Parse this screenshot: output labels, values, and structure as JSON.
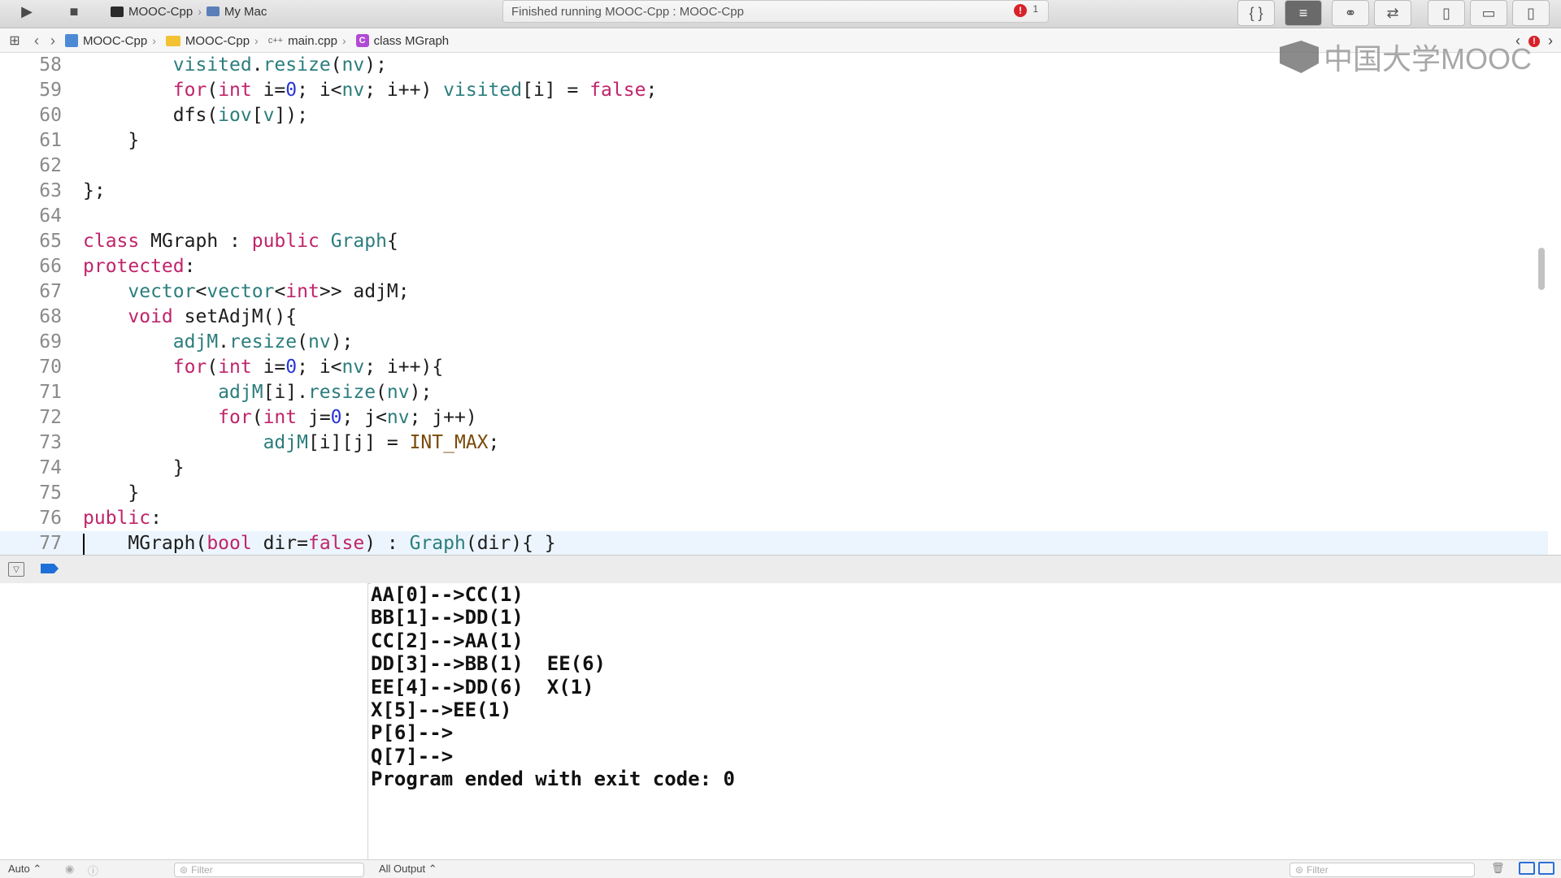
{
  "toolbar": {
    "run_icon": "▶",
    "stop_icon": "■",
    "scheme_name": "MOOC-Cpp",
    "destination": "My Mac",
    "status_text": "Finished running MOOC-Cpp : MOOC-Cpp",
    "error_count": "1",
    "right_buttons": [
      "{ }",
      "≡",
      "⚭",
      "⇄",
      "▯",
      "▭",
      "▯"
    ]
  },
  "jumpbar": {
    "project": "MOOC-Cpp",
    "folder": "MOOC-Cpp",
    "file_icon": "c++",
    "file": "main.cpp",
    "class_icon": "C",
    "symbol": "class MGraph"
  },
  "watermark": {
    "text": "中国大学MOOC"
  },
  "editor": {
    "current_line": "77",
    "lines": [
      {
        "n": "58",
        "html": "        <span class=\"mem\">visited</span>.<span class=\"mem\">resize</span>(<span class=\"mem\">nv</span>);"
      },
      {
        "n": "59",
        "html": "        <span class=\"kw\">for</span>(<span class=\"kw\">int</span> i=<span class=\"num\">0</span>; i&lt;<span class=\"mem\">nv</span>; i++) <span class=\"mem\">visited</span>[i] = <span class=\"kw\">false</span>;"
      },
      {
        "n": "60",
        "html": "        dfs(<span class=\"mem\">iov</span>[<span class=\"mem\">v</span>]);"
      },
      {
        "n": "61",
        "html": "    }"
      },
      {
        "n": "62",
        "html": ""
      },
      {
        "n": "63",
        "html": "};"
      },
      {
        "n": "64",
        "html": ""
      },
      {
        "n": "65",
        "html": "<span class=\"kw\">class</span> MGraph : <span class=\"kw\">public</span> <span class=\"ty\">Graph</span>{"
      },
      {
        "n": "66",
        "html": "<span class=\"kw\">protected</span>:"
      },
      {
        "n": "67",
        "html": "    <span class=\"ty\">vector</span>&lt;<span class=\"ty\">vector</span>&lt;<span class=\"kw\">int</span>&gt;&gt; adjM;"
      },
      {
        "n": "68",
        "html": "    <span class=\"kw\">void</span> setAdjM(){"
      },
      {
        "n": "69",
        "html": "        <span class=\"mem\">adjM</span>.<span class=\"mem\">resize</span>(<span class=\"mem\">nv</span>);"
      },
      {
        "n": "70",
        "html": "        <span class=\"kw\">for</span>(<span class=\"kw\">int</span> i=<span class=\"num\">0</span>; i&lt;<span class=\"mem\">nv</span>; i++){"
      },
      {
        "n": "71",
        "html": "            <span class=\"mem\">adjM</span>[i].<span class=\"mem\">resize</span>(<span class=\"mem\">nv</span>);"
      },
      {
        "n": "72",
        "html": "            <span class=\"kw\">for</span>(<span class=\"kw\">int</span> j=<span class=\"num\">0</span>; j&lt;<span class=\"mem\">nv</span>; j++)"
      },
      {
        "n": "73",
        "html": "                <span class=\"mem\">adjM</span>[i][j] = <span class=\"mac\">INT_MAX</span>;"
      },
      {
        "n": "74",
        "html": "        }"
      },
      {
        "n": "75",
        "html": "    }"
      },
      {
        "n": "76",
        "html": "<span class=\"kw\">public</span>:"
      },
      {
        "n": "77",
        "html": "    MGraph(<span class=\"kw\">bool</span> dir=<span class=\"kw\">false</span>) : <span class=\"ty\">Graph</span>(dir){ }"
      }
    ]
  },
  "console": {
    "output": [
      "AA[0]-->CC(1)",
      "BB[1]-->DD(1)",
      "CC[2]-->AA(1)",
      "DD[3]-->BB(1)  EE(6)",
      "EE[4]-->DD(6)  X(1)",
      "X[5]-->EE(1)",
      "P[6]-->",
      "Q[7]-->",
      "Program ended with exit code: 0"
    ]
  },
  "bottombar": {
    "auto_label": "Auto ⌃",
    "filter_placeholder": "Filter",
    "all_output_label": "All Output ⌃",
    "filter_placeholder_right": "Filter"
  },
  "colors": {
    "keyword": "#c0246b",
    "type": "#2c7d7d",
    "number": "#2a35d8",
    "current_line_bg": "#ecf5fd",
    "breakpoint": "#1f6fd8",
    "error": "#d8222a"
  }
}
